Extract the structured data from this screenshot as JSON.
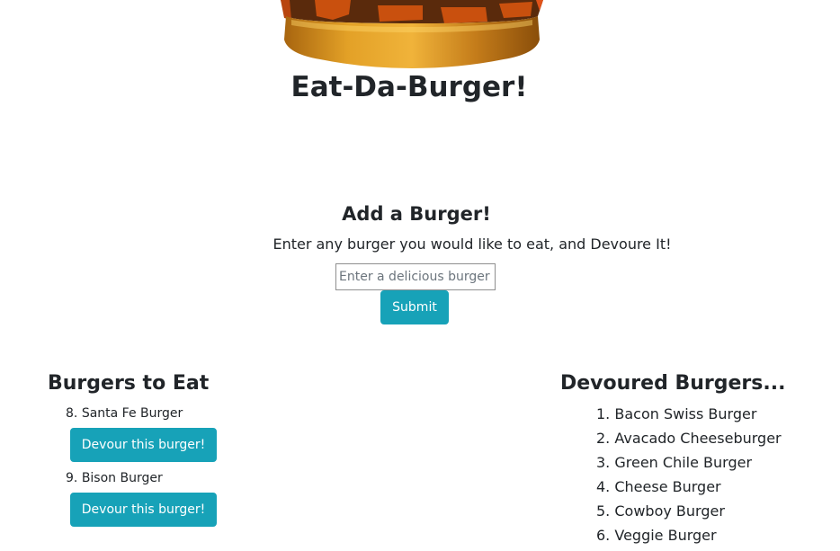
{
  "header": {
    "title": "Eat-Da-Burger!"
  },
  "add_form": {
    "title": "Add a Burger!",
    "description": "Enter any burger you would like to eat, and Devoure It!",
    "input_placeholder": "Enter a delicious burger",
    "input_value": "",
    "submit_label": "Submit"
  },
  "to_eat": {
    "title": "Burgers to Eat",
    "items": [
      {
        "number": "8.",
        "name": "Santa Fe Burger",
        "button_label": "Devour this burger!"
      },
      {
        "number": "9.",
        "name": "Bison Burger",
        "button_label": "Devour this burger!"
      }
    ]
  },
  "devoured": {
    "title": "Devoured Burgers...",
    "items": [
      {
        "number": "1.",
        "name": "Bacon Swiss Burger"
      },
      {
        "number": "2.",
        "name": "Avacado Cheeseburger"
      },
      {
        "number": "3.",
        "name": "Green Chile Burger"
      },
      {
        "number": "4.",
        "name": "Cheese Burger"
      },
      {
        "number": "5.",
        "name": "Cowboy Burger"
      },
      {
        "number": "6.",
        "name": "Veggie Burger"
      }
    ]
  },
  "colors": {
    "accent": "#17a2b8",
    "text": "#212529",
    "bun": "#e8a72c",
    "patty": "#5a2a0c",
    "cheese": "#c9500e"
  },
  "icons": {
    "logo": "burger-logo-icon"
  }
}
